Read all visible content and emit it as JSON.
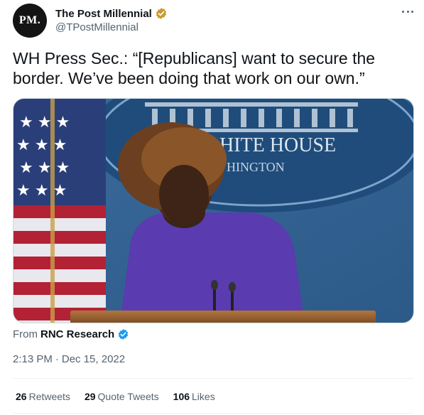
{
  "account": {
    "avatar_text": "PM.",
    "display_name": "The Post Millennial",
    "handle": "@TPostMillennial",
    "verified_color": "#c99a2e"
  },
  "menu": {
    "icon": "more-icon"
  },
  "tweet": {
    "text": "WH Press Sec.: “[Republicans] want to secure the border. We’ve been doing that work on our own.”"
  },
  "media": {
    "type": "video-still",
    "backdrop_text_line1": "HITE HOUSE",
    "backdrop_text_line2": "HINGTON"
  },
  "attribution": {
    "label": "From",
    "source": "RNC Research",
    "verified_color": "#1d9bf0"
  },
  "timestamp": {
    "time": "2:13 PM",
    "separator": "·",
    "date": "Dec 15, 2022"
  },
  "stats": {
    "retweets_count": "26",
    "retweets_label": "Retweets",
    "quotes_count": "29",
    "quotes_label": "Quote Tweets",
    "likes_count": "106",
    "likes_label": "Likes"
  }
}
